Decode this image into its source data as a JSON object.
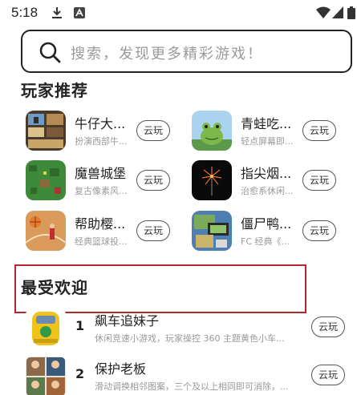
{
  "status_bar": {
    "time": "5:18"
  },
  "search": {
    "placeholder": "搜索，发现更多精彩游戏！"
  },
  "sections": {
    "recommend_title": "玩家推荐",
    "popular_title": "最受欢迎"
  },
  "cloud_label": "云玩",
  "recommend_games": [
    {
      "name": "牛仔大...",
      "desc": "扮演西部牛..."
    },
    {
      "name": "青蛙吃...",
      "desc": "轻点屏幕即..."
    },
    {
      "name": "魔兽城堡",
      "desc": "复古像素风..."
    },
    {
      "name": "指尖烟...",
      "desc": "治愈系休闲..."
    },
    {
      "name": "帮助樱...",
      "desc": "经典篮球投..."
    },
    {
      "name": "僵尸鸭...",
      "desc": "FC 经典《..."
    }
  ],
  "popular_games": [
    {
      "rank": "1",
      "name": "飙车追妹子",
      "desc": "休闲竞速小游戏，玩家操控 360 主题黄色小车..."
    },
    {
      "rank": "2",
      "name": "保护老板",
      "desc": "滑动调换相邻图案，三个及以上相同即可消除，..."
    }
  ],
  "colors": {
    "highlight_border": "#b5262b",
    "placeholder": "#9a9a9a"
  }
}
